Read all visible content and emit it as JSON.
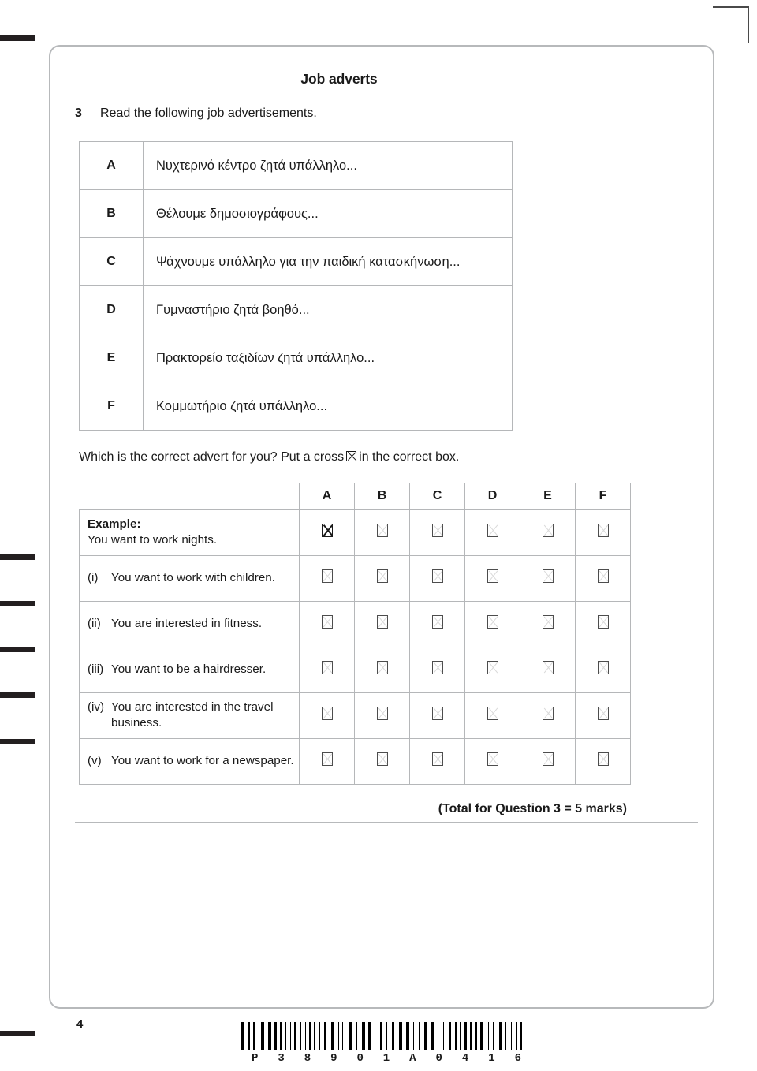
{
  "section": {
    "heading": "Job adverts"
  },
  "question": {
    "number": "3",
    "prompt": "Read the following job advertisements.",
    "instruction_before": "Which is the correct advert for you? Put a cross",
    "instruction_after": "in the correct box."
  },
  "adverts": [
    {
      "letter": "A",
      "text": "Νυχτερινό κέντρο ζητά υπάλληλο..."
    },
    {
      "letter": "B",
      "text": "Θέλουμε δημοσιογράφους..."
    },
    {
      "letter": "C",
      "text": "Ψάχνουμε υπάλληλο για την παιδική κατασκήνωση..."
    },
    {
      "letter": "D",
      "text": "Γυμναστήριο ζητά βοηθό..."
    },
    {
      "letter": "E",
      "text": "Πρακτορείο ταξιδίων ζητά υπάλληλο..."
    },
    {
      "letter": "F",
      "text": "Κομμωτήριο ζητά υπάλληλο..."
    }
  ],
  "answer_grid": {
    "columns": [
      "A",
      "B",
      "C",
      "D",
      "E",
      "F"
    ],
    "rows": [
      {
        "id": "example",
        "label": "Example:",
        "marker": "",
        "text": "You want to work nights.",
        "checked": "A"
      },
      {
        "id": "i",
        "label": "",
        "marker": "(i)",
        "text": "You want to work with children.",
        "checked": ""
      },
      {
        "id": "ii",
        "label": "",
        "marker": "(ii)",
        "text": "You are interested in fitness.",
        "checked": ""
      },
      {
        "id": "iii",
        "label": "",
        "marker": "(iii)",
        "text": "You want to be a hairdresser.",
        "checked": ""
      },
      {
        "id": "iv",
        "label": "",
        "marker": "(iv)",
        "text": "You are interested in the travel business.",
        "checked": ""
      },
      {
        "id": "v",
        "label": "",
        "marker": "(v)",
        "text": "You want to work for a newspaper.",
        "checked": ""
      }
    ]
  },
  "total": {
    "text": "(Total for Question 3 = 5 marks)"
  },
  "footer": {
    "page_number": "4",
    "barcode_digits": [
      "P",
      "3",
      "8",
      "9",
      "0",
      "1",
      "A",
      "0",
      "4",
      "1",
      "6"
    ]
  },
  "colors": {
    "frame_border": "#b7b9bb",
    "table_border": "#b5b7b9",
    "text": "#1a1a1a",
    "mark_faint": "#d9d9d9",
    "reg_bar": "#231f20"
  }
}
